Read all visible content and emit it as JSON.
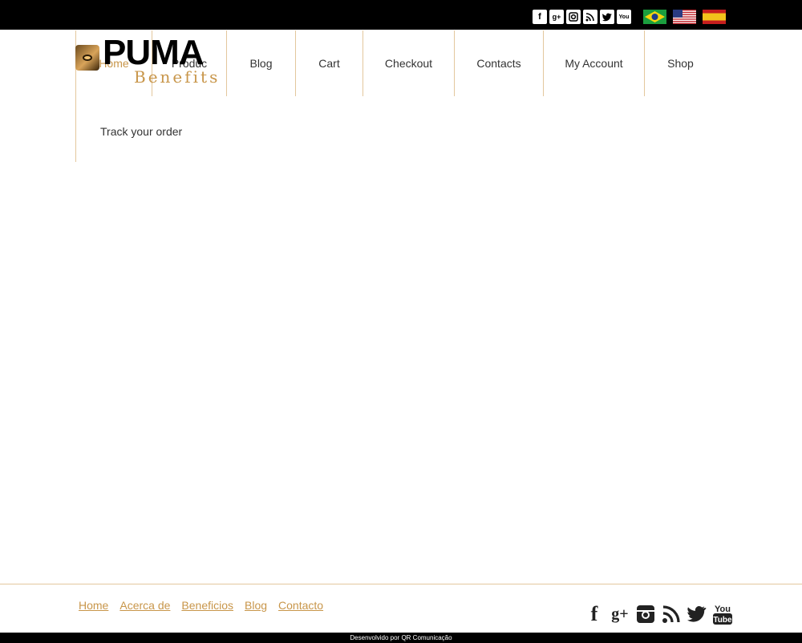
{
  "header_icons": {
    "social": [
      "facebook-icon",
      "google-plus-icon",
      "instagram-icon",
      "rss-icon",
      "twitter-icon",
      "youtube-icon"
    ],
    "flags": [
      "brazil-flag",
      "usa-flag",
      "spain-flag"
    ]
  },
  "logo": {
    "primary": "PUMA",
    "secondary": "Benefits"
  },
  "nav": {
    "items": [
      {
        "label": "Home",
        "active": true
      },
      {
        "label": "Produc"
      },
      {
        "label": "Blog"
      },
      {
        "label": "Cart"
      },
      {
        "label": "Checkout"
      },
      {
        "label": "Contacts"
      },
      {
        "label": "My Account"
      },
      {
        "label": "Shop"
      }
    ],
    "submenu_label": "Track your order"
  },
  "footer": {
    "links": [
      "Home",
      "Acerca de",
      "Beneficios",
      "Blog",
      "Contacto"
    ],
    "credit": "Desenvolvido por QR Comunicação"
  },
  "colors": {
    "accent": "#c8964a",
    "topbar": "#000000"
  }
}
